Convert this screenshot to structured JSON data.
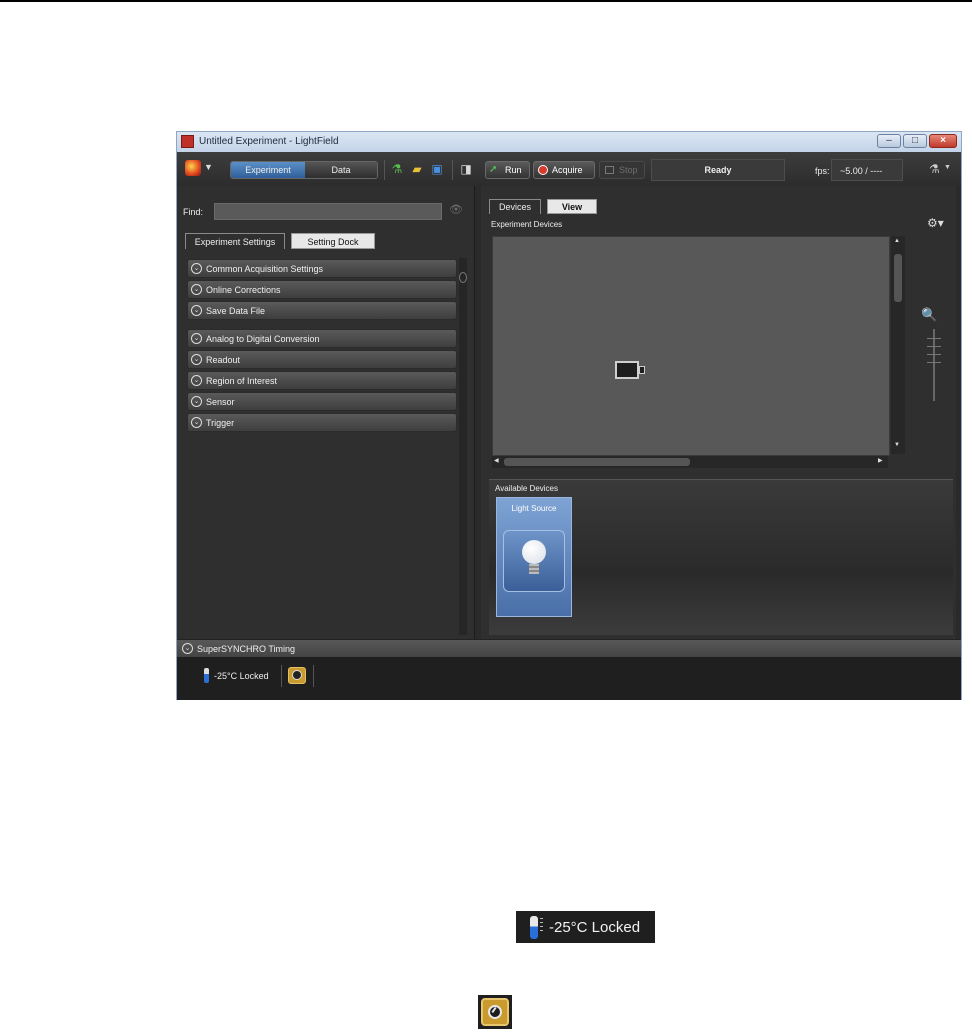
{
  "window": {
    "title": "Untitled Experiment - LightField",
    "controls": {
      "minimize": "–",
      "maximize": "□",
      "close": "×"
    }
  },
  "toolbar": {
    "mode_experiment": "Experiment",
    "mode_data": "Data",
    "run_label": "Run",
    "acquire_label": "Acquire",
    "stop_label": "Stop",
    "status": "Ready",
    "fps_label": "fps:",
    "fps_value": "~5.00 / ----"
  },
  "left_panel": {
    "find_label": "Find:",
    "find_value": "",
    "tabs": [
      "Experiment Settings",
      "Setting Dock"
    ],
    "sections": [
      "Common Acquisition Settings",
      "Online Corrections",
      "Save Data File",
      "Analog to Digital Conversion",
      "Readout",
      "Region of Interest",
      "Sensor",
      "Trigger"
    ]
  },
  "right_panel": {
    "tabs": [
      "Devices",
      "View"
    ],
    "experiment_devices_title": "Experiment Devices",
    "available_devices_title": "Available Devices",
    "available_devices": [
      "Light Source"
    ]
  },
  "bottom": {
    "sync_label": "SuperSYNCHRO Timing",
    "temperature_status": "-25°C Locked"
  },
  "callouts": {
    "temperature_status": "-25°C Locked"
  },
  "colors": {
    "accent_blue": "#2f5f98",
    "record_red": "#d93a2a",
    "gauge_gold": "#c99a2e"
  },
  "icons": {
    "app": "lightfield-logo-icon",
    "flask": "flask-icon",
    "folder": "folder-open-icon",
    "save": "save-icon",
    "camera": "camera-device-icon",
    "settings": "gear-icon",
    "zoom": "zoom-icon",
    "bulb": "light-bulb-icon",
    "thermometer": "thermometer-icon",
    "gauge": "gauge-icon"
  }
}
